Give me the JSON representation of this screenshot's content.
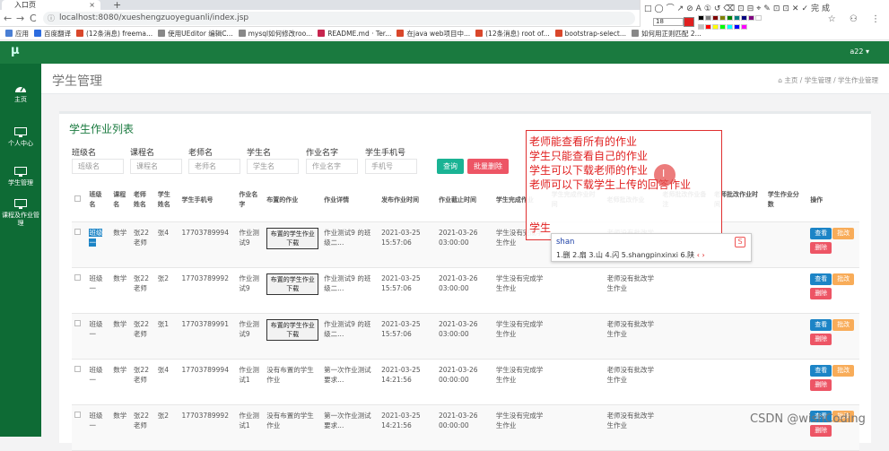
{
  "browser": {
    "tab_title": "入口页",
    "new_tab": "+",
    "close_tab": "×",
    "back": "←",
    "forward": "→",
    "reload": "C",
    "url": "localhost:8080/xueshengzuoyeguanli/index.jsp",
    "bookmarks": [
      {
        "label": "应用",
        "color": "#4a7fd4"
      },
      {
        "label": "百度翻译",
        "color": "#2d6cdf"
      },
      {
        "label": "(12条消息) freema...",
        "color": "#d9472b"
      },
      {
        "label": "使用UEditor 编辑C...",
        "color": "#888888"
      },
      {
        "label": "mysql如何修改roo...",
        "color": "#888888"
      },
      {
        "label": "README.md · Ter...",
        "color": "#c7254e"
      },
      {
        "label": "在java web项目中...",
        "color": "#d9472b"
      },
      {
        "label": "(12条消息) root of...",
        "color": "#d9472b"
      },
      {
        "label": "bootstrap-select...",
        "color": "#d9472b"
      },
      {
        "label": "如何用正则匹配 2...",
        "color": "#888888"
      }
    ],
    "right_icons": "☆ ⚇ ⋮"
  },
  "annot_toolbar": {
    "row1": "□◯⌒↗⊘A①↺⌫⊡⊟⌖✎⊡⊡✕✓完成",
    "font_size": "18",
    "accent_color": "#e02020",
    "palette": [
      "#000000",
      "#808080",
      "#800000",
      "#808000",
      "#008000",
      "#008080",
      "#000080",
      "#800080",
      "#ffffff",
      "#c0c0c0",
      "#ff0000",
      "#ffff00",
      "#00ff00",
      "#00ffff",
      "#0000ff",
      "#ff00ff"
    ]
  },
  "app": {
    "logo": "μ",
    "user": "a22 ▾",
    "sidebar": [
      {
        "label": "主页",
        "icon": "dashboard-icon"
      },
      {
        "label": "个人中心",
        "icon": "monitor-icon"
      },
      {
        "label": "学生管理",
        "icon": "monitor-icon"
      },
      {
        "label": "课程及作业管理",
        "icon": "monitor-icon"
      }
    ],
    "page_title": "学生管理",
    "breadcrumb": "⌂ 主页  /  学生管理  /  学生作业管理",
    "card_title": "学生作业列表",
    "filters": [
      {
        "label": "班级名",
        "placeholder": "班级名"
      },
      {
        "label": "课程名",
        "placeholder": "课程名"
      },
      {
        "label": "老师名",
        "placeholder": "老师名"
      },
      {
        "label": "学生名",
        "placeholder": "学生名"
      },
      {
        "label": "作业名字",
        "placeholder": "作业名字"
      },
      {
        "label": "学生手机号",
        "placeholder": "手机号"
      }
    ],
    "search_btn": "查询",
    "batch_delete_btn": "批量删除",
    "columns": [
      "",
      "班级名",
      "课程名",
      "老师姓名",
      "学生姓名",
      "学生手机号",
      "作业名字",
      "布置的作业",
      "作业详情",
      "发布作业时间",
      "作业截止时间",
      "学生完成作业",
      "学生完成作业时间",
      "老师批改作业",
      "老师批改作业备注",
      "老师批改作业时间",
      "学生作业分数",
      "操作"
    ],
    "rows": [
      {
        "cls": "班级一",
        "course": "数学",
        "teacher": "张22老师",
        "student": "张4",
        "phone": "17703789994",
        "hw": "作业测试9",
        "dl": "布置的学生作业下载",
        "detail": "作业测试9 的班级二...",
        "pub": "2021-03-25 15:57:06",
        "due": "2021-03-26 03:00:00",
        "done": "学生没有完成学生作业",
        "done_time": "",
        "review": "老师没有批改学生作业",
        "note": "",
        "review_time": "",
        "score": ""
      },
      {
        "cls": "班级一",
        "course": "数学",
        "teacher": "张22老师",
        "student": "张2",
        "phone": "17703789992",
        "hw": "作业测试9",
        "dl": "布置的学生作业下载",
        "detail": "作业测试9 的班级二...",
        "pub": "2021-03-25 15:57:06",
        "due": "2021-03-26 03:00:00",
        "done": "学生没有完成学生作业",
        "done_time": "",
        "review": "老师没有批改学生作业",
        "note": "",
        "review_time": "",
        "score": ""
      },
      {
        "cls": "班级一",
        "course": "数学",
        "teacher": "张22老师",
        "student": "张1",
        "phone": "17703789991",
        "hw": "作业测试9",
        "dl": "布置的学生作业下载",
        "detail": "作业测试9 的班级二...",
        "pub": "2021-03-25 15:57:06",
        "due": "2021-03-26 03:00:00",
        "done": "学生没有完成学生作业",
        "done_time": "",
        "review": "老师没有批改学生作业",
        "note": "",
        "review_time": "",
        "score": ""
      },
      {
        "cls": "班级一",
        "course": "数学",
        "teacher": "张22老师",
        "student": "张4",
        "phone": "17703789994",
        "hw": "作业测试1",
        "dl": "没有布置的学生作业",
        "detail": "第一次作业测试要求...",
        "pub": "2021-03-25 14:21:56",
        "due": "2021-03-26 00:00:00",
        "done": "学生没有完成学生作业",
        "done_time": "",
        "review": "老师没有批改学生作业",
        "note": "",
        "review_time": "",
        "score": ""
      },
      {
        "cls": "班级一",
        "course": "数学",
        "teacher": "张22老师",
        "student": "张2",
        "phone": "17703789992",
        "hw": "作业测试1",
        "dl": "没有布置的学生作业",
        "detail": "第一次作业测试要求...",
        "pub": "2021-03-25 14:21:56",
        "due": "2021-03-26 00:00:00",
        "done": "学生没有完成学生作业",
        "done_time": "",
        "review": "老师没有批改学生作业",
        "note": "",
        "review_time": "",
        "score": ""
      }
    ],
    "ops": {
      "view": "查看",
      "edit": "批改",
      "del": "删除"
    }
  },
  "note_overlay": {
    "lines": [
      "老师能查看所有的作业",
      "学生只能查看自己的作业",
      "学生可以下载老师的作业",
      "老师可以下载学生上传的回答作业"
    ],
    "typing": "学生"
  },
  "ime": {
    "input": "shan",
    "candidates": "1.删 2.扇 3.山 4.闪 5.shangpinxinxi 6.陕",
    "arrows": "‹ ›",
    "logo": "S"
  },
  "watermark": "CSDN @wishCoding"
}
